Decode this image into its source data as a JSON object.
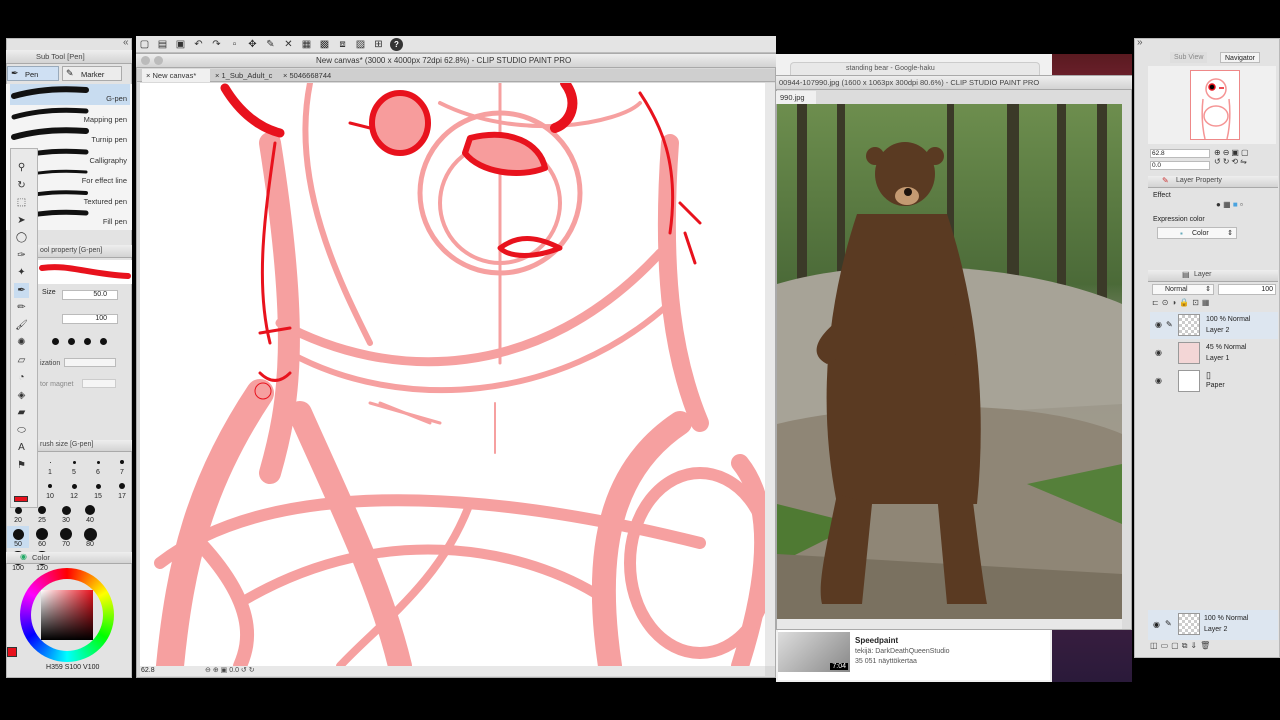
{
  "colors": {
    "accent": "#e8121d",
    "sketch_pink": "#f6a0a0",
    "panel_bg": "#e6e6e6",
    "selected": "#c8dcf0"
  },
  "main_toolbar": {
    "icons": [
      "new-icon",
      "open-icon",
      "save-icon",
      "undo-icon",
      "redo-icon",
      "clear-icon",
      "transform-icon",
      "pen-tool-icon",
      "close-icon",
      "select-all-icon",
      "ruler-icon",
      "snap-icon",
      "grid-icon",
      "crop-icon",
      "help-icon"
    ]
  },
  "sub_tool": {
    "panel_title": "Sub Tool [Pen]",
    "tabs": [
      "Pen",
      "Marker"
    ],
    "brushes": [
      "G-pen",
      "Mapping pen",
      "Turnip pen",
      "Calligraphy",
      "For effect line",
      "Textured pen",
      "Fill pen"
    ]
  },
  "tool_property": {
    "title": "ool property [G-pen]",
    "size_label": "Size",
    "size_value": "50.0",
    "opacity_value": "100",
    "stabilization_label": "ization",
    "vector_magnet_label": "tor magnet"
  },
  "brush_size": {
    "title": "rush size [G-pen]",
    "sizes": [
      "1",
      "5",
      "6",
      "7",
      "10",
      "12",
      "15",
      "17",
      "20",
      "25",
      "30",
      "40",
      "50",
      "60",
      "70",
      "80",
      "100",
      "120"
    ]
  },
  "color_panel": {
    "title": "Color",
    "h": "359",
    "s": "100",
    "v": "100"
  },
  "canvas_window": {
    "title": "New canvas* (3000 x 4000px 72dpi 62.8%) - CLIP STUDIO PAINT PRO",
    "tabs": [
      "New canvas*",
      "1_Sub_Adult_c",
      "5046668744"
    ],
    "zoom": "62.8",
    "bottom_value": "0.0"
  },
  "reference_window": {
    "title": "00944-107990.jpg (1600 x 1063px 300dpi 80.6%) - CLIP STUDIO PAINT PRO",
    "tab": "990.jpg"
  },
  "browser_behind": {
    "tab_title": "standing bear - Google-haku",
    "video_title_line1": "Speedpaint",
    "video_author": "tekijä: DarkDeathQueenStudio",
    "video_views": "35 051 näyttökertaa",
    "video_duration": "7:04"
  },
  "navigator": {
    "tabs": [
      "Sub View",
      "Navigator"
    ],
    "zoom": "62.8",
    "rotation": "0.0"
  },
  "layer_property": {
    "title": "Layer Property",
    "effect_label": "Effect",
    "expression_color_label": "Expression color",
    "expression_color_value": "Color"
  },
  "layers": {
    "title": "Layer",
    "blend_mode": "Normal",
    "opacity": "100",
    "items": [
      {
        "percent_mode": "100 % Normal",
        "name": "Layer 2"
      },
      {
        "percent_mode": "45 % Normal",
        "name": "Layer 1"
      },
      {
        "percent_mode": "",
        "name": "Paper"
      }
    ],
    "footer": {
      "percent_mode": "100 % Normal",
      "name": "Layer 2"
    }
  }
}
